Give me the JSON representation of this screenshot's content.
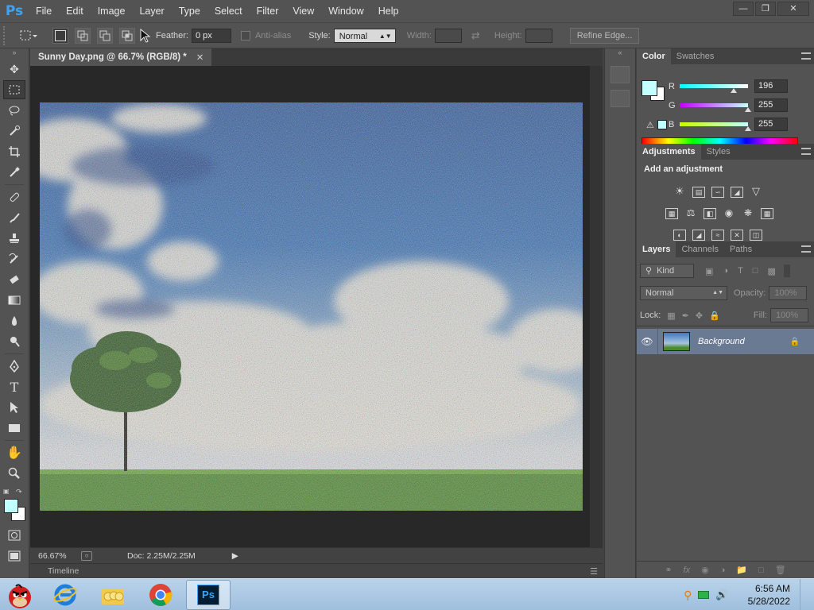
{
  "app": {
    "logo": "Ps"
  },
  "menu": [
    "File",
    "Edit",
    "Image",
    "Layer",
    "Type",
    "Select",
    "Filter",
    "View",
    "Window",
    "Help"
  ],
  "window_controls": [
    "minimize-icon",
    "restore-icon",
    "close-icon"
  ],
  "options_bar": {
    "feather_label": "Feather:",
    "feather_value": "0 px",
    "antialias_label": "Anti-alias",
    "style_label": "Style:",
    "style_value": "Normal",
    "width_label": "Width:",
    "height_label": "Height:",
    "refine_edge_label": "Refine Edge..."
  },
  "document": {
    "tab_title": "Sunny Day.png @ 66.7% (RGB/8) *",
    "zoom": "66.67%",
    "doc_size": "Doc: 2.25M/2.25M",
    "timeline_label": "Timeline"
  },
  "color_panel": {
    "tabs": [
      "Color",
      "Swatches"
    ],
    "foreground": "#c4ffff",
    "r_label": "R",
    "r_value": "196",
    "g_label": "G",
    "g_value": "255",
    "b_label": "B",
    "b_value": "255"
  },
  "adjustments_panel": {
    "tabs": [
      "Adjustments",
      "Styles"
    ],
    "title": "Add an adjustment"
  },
  "layers_panel": {
    "tabs": [
      "Layers",
      "Channels",
      "Paths"
    ],
    "kind_label": "Kind",
    "blend_mode": "Normal",
    "opacity_label": "Opacity:",
    "opacity_value": "100%",
    "lock_label": "Lock:",
    "fill_label": "Fill:",
    "fill_value": "100%",
    "layer_name": "Background"
  },
  "taskbar": {
    "time": "6:56 AM",
    "date": "5/28/2022"
  }
}
